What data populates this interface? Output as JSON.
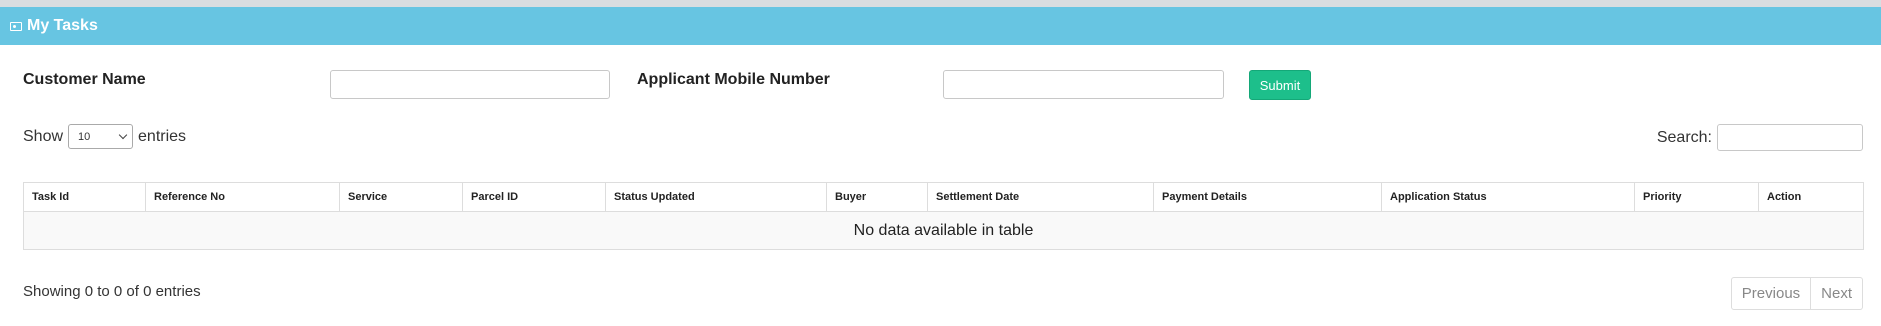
{
  "panel": {
    "title": "My Tasks",
    "icon": "id-card-icon",
    "header_color": "#67c5e2"
  },
  "filters": {
    "customer_name_label": "Customer Name",
    "customer_name_value": "",
    "mobile_label": "Applicant Mobile Number",
    "mobile_value": "",
    "submit_label": "Submit",
    "submit_color": "#1dbf8b"
  },
  "table_controls": {
    "show_label": "Show",
    "page_length": "10",
    "entries_label": "entries",
    "search_label": "Search:",
    "search_value": ""
  },
  "table": {
    "columns": [
      "Task Id",
      "Reference No",
      "Service",
      "Parcel ID",
      "Status Updated",
      "Buyer",
      "Settlement Date",
      "Payment Details",
      "Application Status",
      "Priority",
      "Action"
    ],
    "empty_message": "No data available in table"
  },
  "footer": {
    "info": "Showing 0 to 0 of 0 entries",
    "previous_label": "Previous",
    "next_label": "Next"
  }
}
